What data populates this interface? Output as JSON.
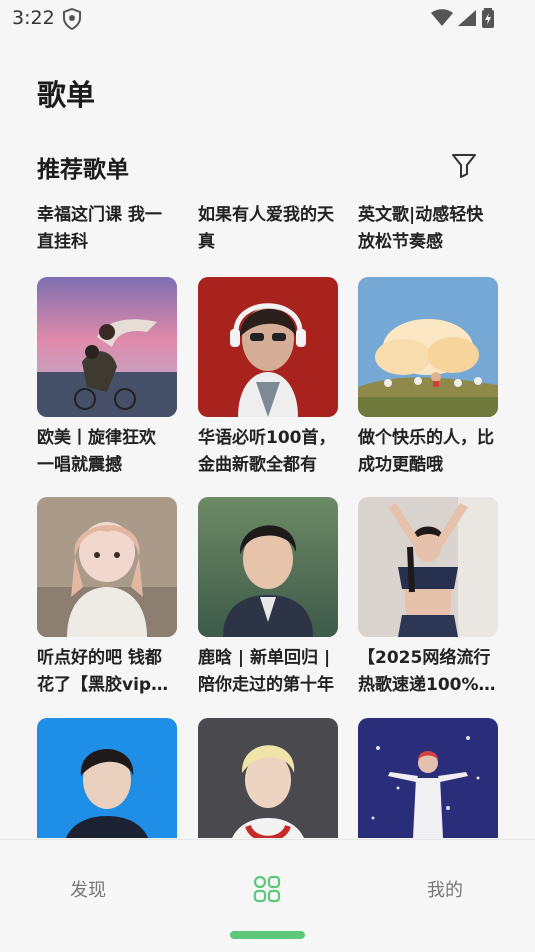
{
  "status": {
    "time": "3:22"
  },
  "page": {
    "title": "歌单"
  },
  "section": {
    "title": "推荐歌单"
  },
  "top_row": [
    {
      "caption": "幸福这门课 我一直挂科"
    },
    {
      "caption": "如果有人爱我的天真"
    },
    {
      "caption": "英文歌|动感轻快放松节奏感"
    }
  ],
  "playlists": [
    {
      "caption": "欧美丨旋律狂欢 一唱就震撼"
    },
    {
      "caption": "华语必听100首，金曲新歌全都有"
    },
    {
      "caption": "做个快乐的人，比成功更酷哦"
    },
    {
      "caption": "听点好的吧 钱都花了【黑胶vip歌单】"
    },
    {
      "caption": "鹿晗 | 新单回归 | 陪你走过的第十年"
    },
    {
      "caption": "【2025网络流行热歌速递100%好听】"
    },
    {
      "caption": ""
    },
    {
      "caption": ""
    },
    {
      "caption": ""
    }
  ],
  "bottom_nav": {
    "discover": "发现",
    "mine": "我的",
    "accent": "#5dc77a"
  }
}
